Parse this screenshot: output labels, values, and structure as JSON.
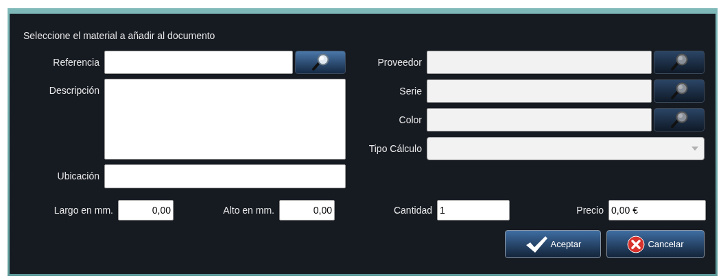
{
  "dialog": {
    "title": "Seleccione el material a añadir al documento"
  },
  "left_fields": [
    {
      "label": "Referencia",
      "kind": "lookup",
      "disabled": false
    },
    {
      "label": "Descripción",
      "kind": "textarea",
      "disabled": false
    },
    {
      "label": "Ubicación",
      "kind": "text",
      "disabled": false
    }
  ],
  "right_fields": [
    {
      "label": "Proveedor",
      "kind": "lookup",
      "disabled": true
    },
    {
      "label": "Serie",
      "kind": "lookup",
      "disabled": true
    },
    {
      "label": "Color",
      "kind": "lookup",
      "disabled": true
    },
    {
      "label": "Tipo Cálculo",
      "kind": "combo",
      "disabled": true
    }
  ],
  "bottom_fields": [
    {
      "label": "Largo en mm.",
      "value": "0,00",
      "kind": "number"
    },
    {
      "label": "Alto en mm.",
      "value": "0,00",
      "kind": "number"
    },
    {
      "label": "Cantidad",
      "value": "1",
      "kind": "text"
    },
    {
      "label": "Precio",
      "value": "0,00 €",
      "kind": "text"
    }
  ],
  "buttons": [
    {
      "label": "Aceptar",
      "kind": "accept"
    },
    {
      "label": "Cancelar",
      "kind": "cancel"
    }
  ]
}
